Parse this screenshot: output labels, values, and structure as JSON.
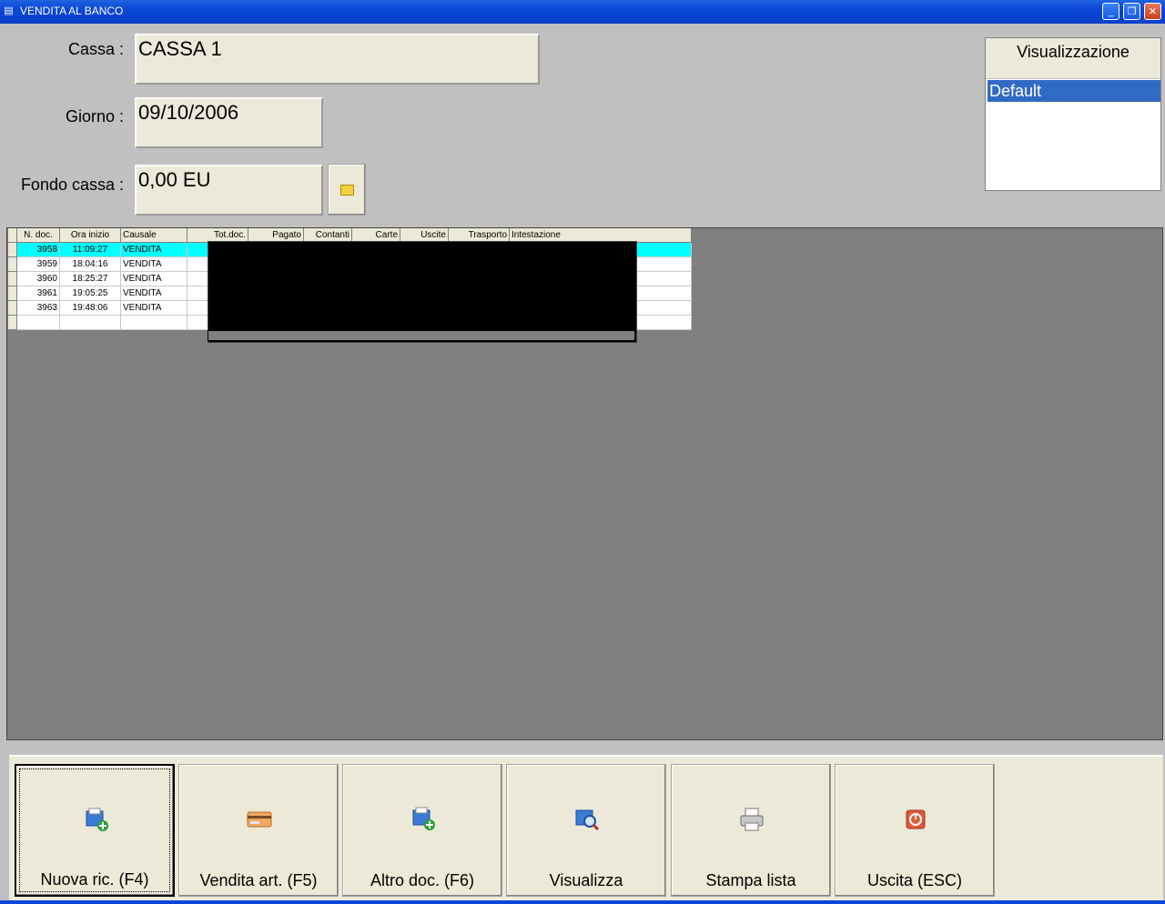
{
  "window": {
    "title": "VENDITA AL BANCO",
    "minimize": "_",
    "restore": "❐",
    "close": "✕"
  },
  "form": {
    "cassa_label": "Cassa :",
    "cassa_value": "CASSA 1",
    "giorno_label": "Giorno :",
    "giorno_value": "09/10/2006",
    "fondo_label": "Fondo cassa :",
    "fondo_value": "0,00 EU"
  },
  "visualizzazione": {
    "header": "Visualizzazione",
    "items": [
      "Default"
    ]
  },
  "table": {
    "columns": [
      "N. doc.",
      "Ora inizio",
      "Causale",
      "Tot.doc.",
      "Pagato",
      "Contanti",
      "Carte",
      "Uscite",
      "Trasporto",
      "Intestazione"
    ],
    "rows": [
      {
        "ndoc": "3958",
        "ora": "11:09:27",
        "causale": "VENDITA"
      },
      {
        "ndoc": "3959",
        "ora": "18:04:16",
        "causale": "VENDITA"
      },
      {
        "ndoc": "3960",
        "ora": "18:25:27",
        "causale": "VENDITA"
      },
      {
        "ndoc": "3961",
        "ora": "19:05:25",
        "causale": "VENDITA"
      },
      {
        "ndoc": "3963",
        "ora": "19:48:06",
        "causale": "VENDITA"
      }
    ]
  },
  "toolbar": {
    "nuova": "Nuova ric. (F4)",
    "vendita": "Vendita art. (F5)",
    "altro": "Altro doc. (F6)",
    "visualizza": "Visualizza",
    "stampa": "Stampa lista",
    "uscita": "Uscita (ESC)"
  },
  "colors": {
    "titlebar": "#0a46d8",
    "selected_row": "#00ffff",
    "list_selection": "#316ac5"
  }
}
